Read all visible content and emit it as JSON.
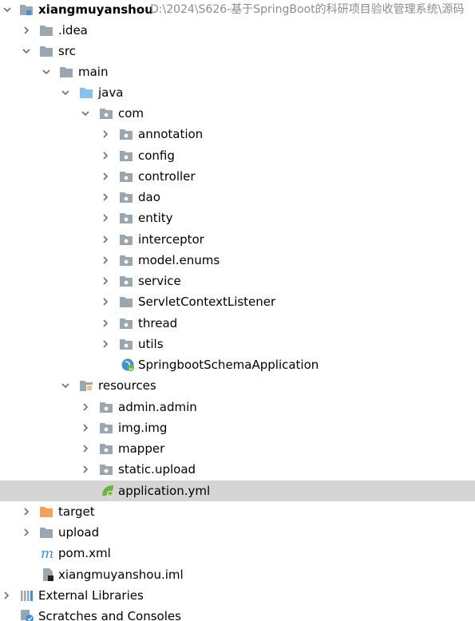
{
  "tree": {
    "project_name": "xiangmuyanshou",
    "project_path": "D:\\2024\\S626-基于SpringBoot的科研项目验收管理系统\\源码",
    "items": [
      {
        "label": "xiangmuyanshou"
      },
      {
        "label": ".idea"
      },
      {
        "label": "src"
      },
      {
        "label": "main"
      },
      {
        "label": "java"
      },
      {
        "label": "com"
      },
      {
        "label": "annotation"
      },
      {
        "label": "config"
      },
      {
        "label": "controller"
      },
      {
        "label": "dao"
      },
      {
        "label": "entity"
      },
      {
        "label": "interceptor"
      },
      {
        "label": "model.enums"
      },
      {
        "label": "service"
      },
      {
        "label": "ServletContextListener"
      },
      {
        "label": "thread"
      },
      {
        "label": "utils"
      },
      {
        "label": "SpringbootSchemaApplication"
      },
      {
        "label": "resources"
      },
      {
        "label": "admin.admin"
      },
      {
        "label": "img.img"
      },
      {
        "label": "mapper"
      },
      {
        "label": "static.upload"
      },
      {
        "label": "application.yml"
      },
      {
        "label": "target"
      },
      {
        "label": "upload"
      },
      {
        "label": "pom.xml"
      },
      {
        "label": "xiangmuyanshou.iml"
      },
      {
        "label": "External Libraries"
      },
      {
        "label": "Scratches and Consoles"
      }
    ],
    "selected_item": "application.yml"
  }
}
